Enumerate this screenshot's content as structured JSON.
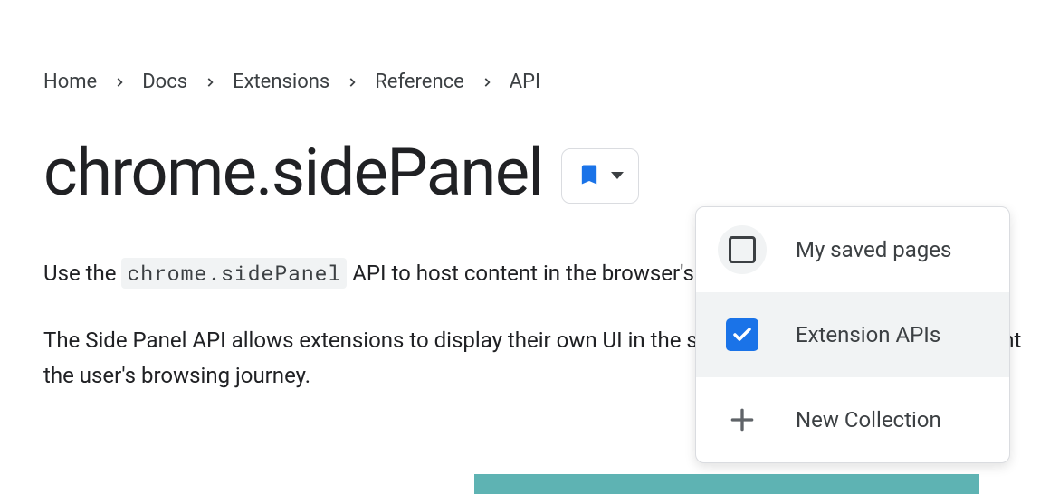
{
  "breadcrumb": {
    "items": [
      "Home",
      "Docs",
      "Extensions",
      "Reference",
      "API"
    ]
  },
  "page": {
    "title": "chrome.sidePanel"
  },
  "body": {
    "para1_pre": "Use the ",
    "para1_code": "chrome.sidePanel",
    "para1_post": " API to host content in the browser's side panel alongside t",
    "para2": "The Side Panel API allows extensions to display their own UI in the side panel, enabling p complement the user's browsing journey."
  },
  "dropdown": {
    "items": [
      {
        "label": "My saved pages",
        "checked": false
      },
      {
        "label": "Extension APIs",
        "checked": true
      }
    ],
    "new_label": "New Collection"
  }
}
